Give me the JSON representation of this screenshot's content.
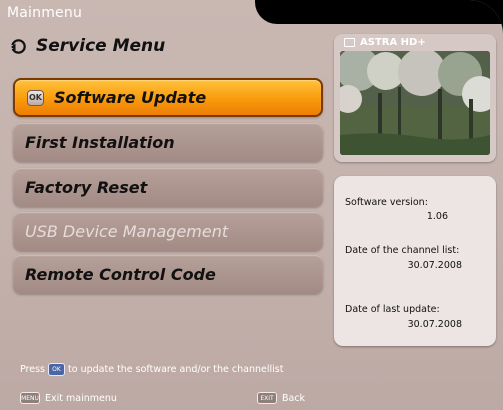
{
  "header": {
    "title": "Mainmenu",
    "subtitle": "Service Menu"
  },
  "menu": {
    "items": [
      {
        "label": "Software Update"
      },
      {
        "label": "First Installation"
      },
      {
        "label": "Factory Reset"
      },
      {
        "label": "USB Device Management"
      },
      {
        "label": "Remote Control Code"
      }
    ]
  },
  "preview": {
    "channel": "ASTRA HD+"
  },
  "info": {
    "software_version_label": "Software version:",
    "software_version_value": "1.06",
    "channel_list_label": "Date of the channel list:",
    "channel_list_value": "30.07.2008",
    "last_update_label": "Date of last update:",
    "last_update_value": "30.07.2008"
  },
  "hint": {
    "prefix": "Press",
    "text": "to update the software and/or the channellist",
    "key_label": "OK"
  },
  "footer": {
    "exit_key": "MENU",
    "exit_label": "Exit mainmenu",
    "back_key": "EXIT",
    "back_label": "Back"
  },
  "colors": {
    "selected_bg": "#f99a0b",
    "menu_bg": "#a38b85",
    "panel_bg": "#c9b7b2"
  }
}
